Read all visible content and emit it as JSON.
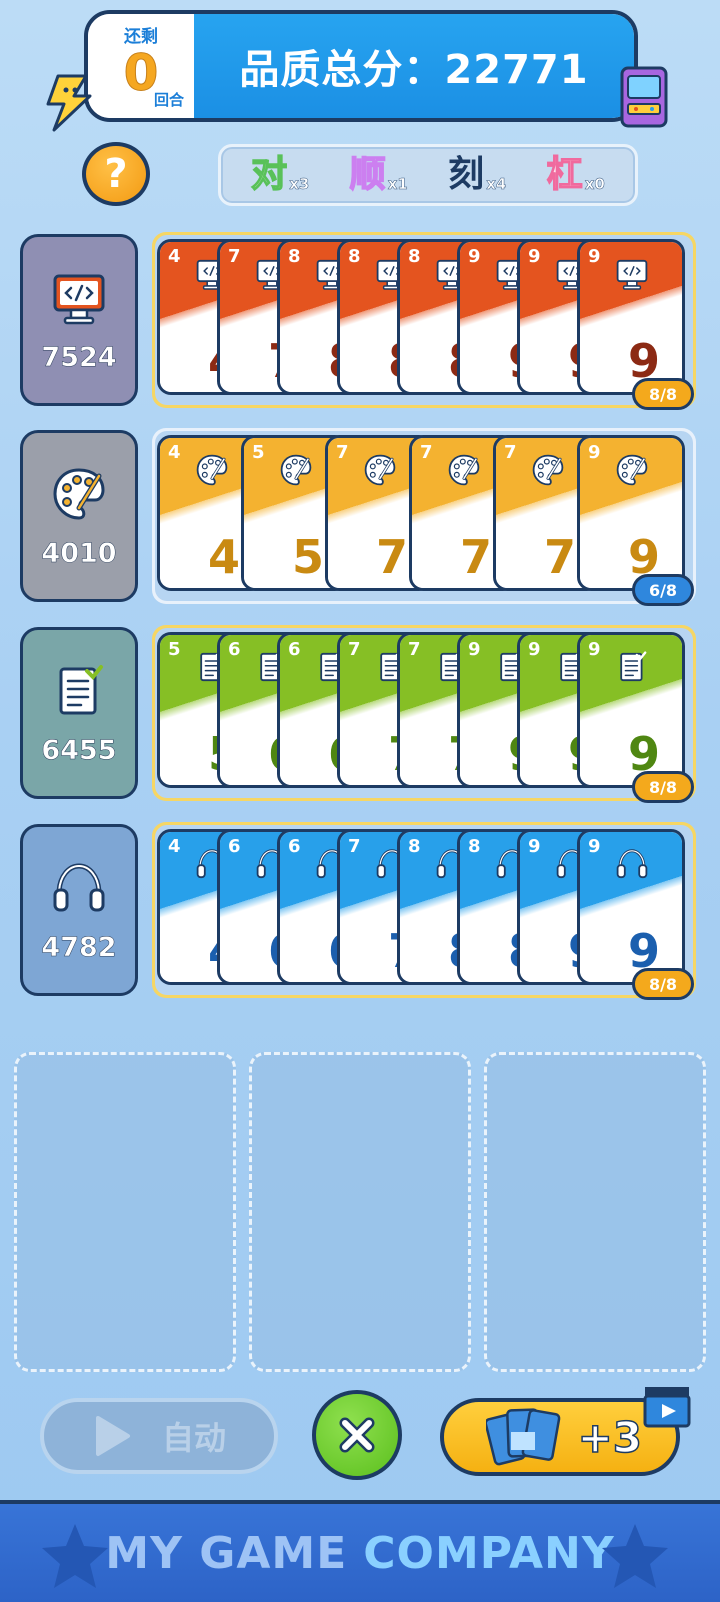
{
  "header": {
    "remaining_label": "还剩",
    "remaining_value": "0",
    "rounds_label": "回合",
    "score_text": "品质总分：22771"
  },
  "help": {
    "label": "?"
  },
  "combos": [
    {
      "key": "对",
      "count": "x3"
    },
    {
      "key": "顺",
      "count": "x1"
    },
    {
      "key": "刻",
      "count": "x4"
    },
    {
      "key": "杠",
      "count": "x0"
    }
  ],
  "rows": [
    {
      "name": "code",
      "icon": "monitor-code-icon",
      "score": "7524",
      "color": "#e4541f",
      "text_color": "#8c2a14",
      "tile_bg": "#8f8fb3",
      "cards": [
        "4",
        "7",
        "8",
        "8",
        "8",
        "9",
        "9",
        "9"
      ],
      "badge": "8/8",
      "badge_color": "#f4a91c",
      "full": true
    },
    {
      "name": "art",
      "icon": "palette-icon",
      "score": "4010",
      "color": "#f4b230",
      "text_color": "#c98a12",
      "tile_bg": "#9b9faa",
      "cards": [
        "4",
        "5",
        "7",
        "7",
        "7",
        "9"
      ],
      "badge": "6/8",
      "badge_color": "#2f87dd",
      "full": false
    },
    {
      "name": "doc",
      "icon": "document-icon",
      "score": "6455",
      "color": "#86bf25",
      "text_color": "#4f8712",
      "tile_bg": "#7aa6a8",
      "cards": [
        "5",
        "6",
        "6",
        "7",
        "7",
        "9",
        "9",
        "9"
      ],
      "badge": "8/8",
      "badge_color": "#f4a91c",
      "full": true
    },
    {
      "name": "audio",
      "icon": "headphones-icon",
      "score": "4782",
      "color": "#28a0ea",
      "text_color": "#1b5fae",
      "tile_bg": "#7ea6d4",
      "cards": [
        "4",
        "6",
        "6",
        "7",
        "8",
        "8",
        "9",
        "9"
      ],
      "badge": "8/8",
      "badge_color": "#f4a91c",
      "full": true
    }
  ],
  "controls": {
    "auto_label": "自动",
    "plus_label": "+3"
  },
  "footer": {
    "brand_part1": "MY GAME",
    "brand_part2": "COMPANY"
  }
}
